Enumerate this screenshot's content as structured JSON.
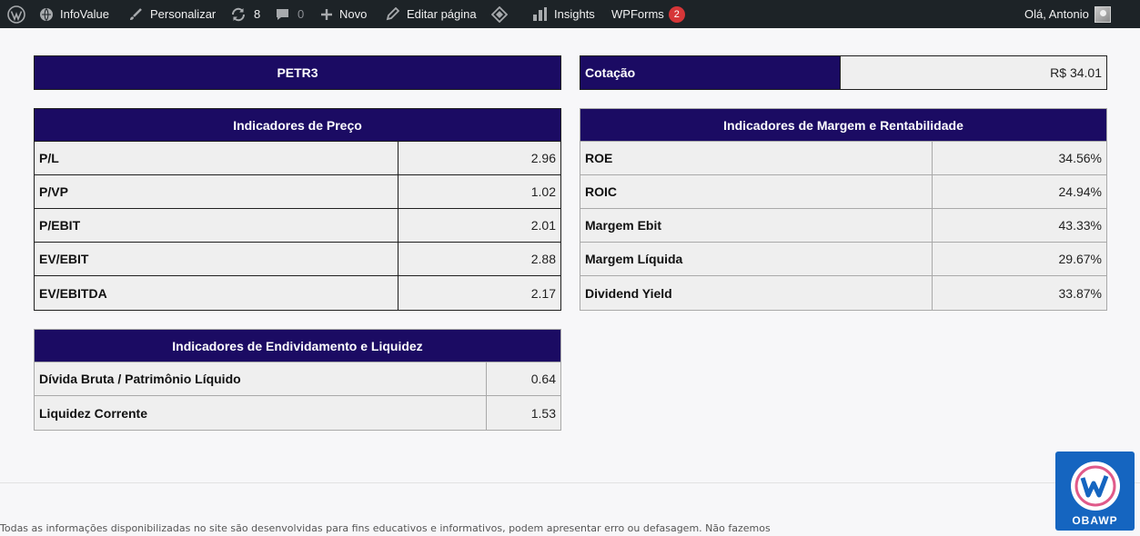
{
  "adminbar": {
    "site_name": "InfoValue",
    "customize": "Personalizar",
    "updates_count": "8",
    "comments_count": "0",
    "new": "Novo",
    "edit_page": "Editar página",
    "insights": "Insights",
    "wpforms": "WPForms",
    "wpforms_badge": "2",
    "greeting": "Olá, Antonio"
  },
  "ticker": {
    "symbol": "PETR3",
    "quote_label": "Cotação",
    "quote_value": "R$ 34.01"
  },
  "price_indicators": {
    "title": "Indicadores de Preço",
    "rows": [
      {
        "label": "P/L",
        "value": "2.96"
      },
      {
        "label": "P/VP",
        "value": "1.02"
      },
      {
        "label": "P/EBIT",
        "value": "2.01"
      },
      {
        "label": "EV/EBIT",
        "value": "2.88"
      },
      {
        "label": "EV/EBITDA",
        "value": "2.17"
      }
    ]
  },
  "margin_indicators": {
    "title": "Indicadores de Margem e Rentabilidade",
    "rows": [
      {
        "label": "ROE",
        "value": "34.56%"
      },
      {
        "label": "ROIC",
        "value": "24.94%"
      },
      {
        "label": "Margem Ebit",
        "value": "43.33%"
      },
      {
        "label": "Margem Líquida",
        "value": "29.67%"
      },
      {
        "label": "Dividend Yield",
        "value": "33.87%"
      }
    ]
  },
  "debt_indicators": {
    "title": "Indicadores de Endividamento e Liquidez",
    "rows": [
      {
        "label": "Dívida Bruta / Patrimônio Líquido",
        "value": "0.64"
      },
      {
        "label": "Liquidez Corrente",
        "value": "1.53"
      }
    ]
  },
  "footer": {
    "disclaimer": "Todas as informações disponibilizadas no site são desenvolvidas para fins educativos e informativos, podem apresentar erro ou defasagem. Não fazemos"
  },
  "badge_widget": {
    "label": "OBAWP"
  },
  "colors": {
    "header_bg": "#1b0b63",
    "adminbar_bg": "#1d2327",
    "badge_red": "#d63638"
  }
}
